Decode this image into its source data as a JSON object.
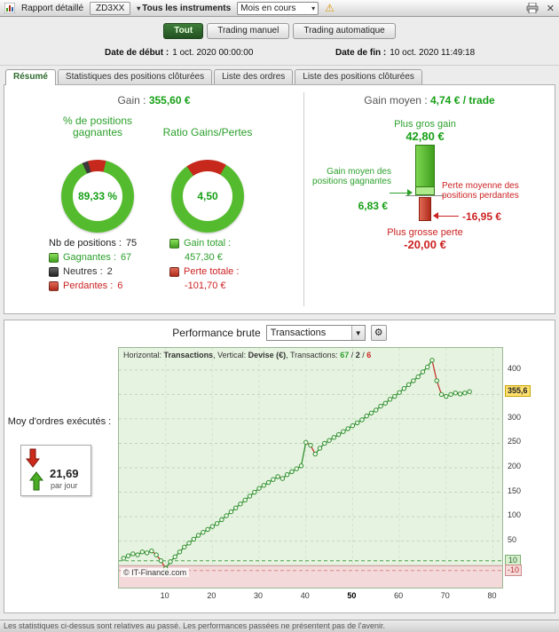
{
  "titlebar": {
    "title": "Rapport détaillé",
    "doc_tab": "ZD3XX",
    "instruments": "Tous les instruments",
    "period": "Mois en cours"
  },
  "filters": {
    "options": [
      "Tout",
      "Trading manuel",
      "Trading automatique"
    ],
    "selected": "Tout"
  },
  "dates": {
    "start_label": "Date de début :",
    "start_value": "1 oct. 2020 00:00:00",
    "end_label": "Date de fin :",
    "end_value": "10 oct. 2020 11:49:18"
  },
  "tabs": {
    "items": [
      "Résumé",
      "Statistiques des positions clôturées",
      "Liste des ordres",
      "Liste des positions clôturées"
    ],
    "active": "Résumé"
  },
  "summary": {
    "gain_label": "Gain :",
    "gain_value": "355,60 €",
    "pct_label": "% de positions gagnantes",
    "ratio_label": "Ratio Gains/Pertes",
    "pct_value": "89,33 %",
    "ratio_value": "4,50",
    "donut1": {
      "neutres": 2.67,
      "perdantes": 8.0,
      "gagnantes": 89.33
    },
    "donut2": {
      "red": 18.2,
      "green": 81.8
    },
    "nb_label": "Nb de positions :",
    "nb_value": "75",
    "legend": [
      {
        "label": "Gagnantes :",
        "value": "67"
      },
      {
        "label": "Neutres :",
        "value": "2"
      },
      {
        "label": "Perdantes :",
        "value": "6"
      }
    ],
    "gain_total_label": "Gain total :",
    "gain_total_value": "457,30 €",
    "perte_totale_label": "Perte totale :",
    "perte_totale_value": "-101,70 €"
  },
  "gain_moyen": {
    "label": "Gain moyen :",
    "value": "4,74 € / trade",
    "plus_gros_gain_label": "Plus gros gain",
    "plus_gros_gain": "42,80 €",
    "gain_moyen_gagnantes_label": "Gain moyen des positions gagnantes",
    "gain_moyen_gagnantes": "6,83 €",
    "perte_moyenne_label": "Perte moyenne des positions perdantes",
    "perte_moyenne": "-16,95 €",
    "plus_grosse_perte_label": "Plus grosse perte",
    "plus_grosse_perte": "-20,00 €"
  },
  "performance": {
    "title": "Performance brute",
    "dropdown_value": "Transactions",
    "moy_label": "Moy d'ordres exécutés :",
    "moy_value": "21,69",
    "moy_unit": "par jour"
  },
  "chart_data": {
    "type": "line",
    "title": "Performance brute",
    "header": {
      "h_label": "Horizontal:",
      "h_value": "Transactions",
      "v_label": ", Vertical:",
      "v_value": "Devise (€)",
      "t_label": ", Transactions:",
      "wins": "67",
      "slash1": " / ",
      "neutral": "2",
      "slash2": " / ",
      "losses": "6"
    },
    "values": [
      15,
      20,
      24,
      22,
      28,
      26,
      30,
      22,
      10,
      -6,
      8,
      18,
      28,
      38,
      46,
      54,
      62,
      68,
      74,
      80,
      86,
      94,
      102,
      110,
      118,
      126,
      134,
      142,
      150,
      158,
      164,
      170,
      176,
      182,
      178,
      186,
      192,
      198,
      204,
      252,
      246,
      228,
      240,
      250,
      256,
      262,
      268,
      274,
      280,
      286,
      292,
      298,
      306,
      312,
      318,
      326,
      332,
      340,
      346,
      354,
      362,
      370,
      378,
      386,
      396,
      406,
      420,
      378,
      350,
      346,
      350,
      353,
      351,
      353,
      355.6
    ],
    "current_value": 355.6,
    "current_label": "355,6",
    "yticks": [
      50,
      100,
      150,
      200,
      250,
      300,
      350,
      400
    ],
    "xticks": [
      10,
      20,
      30,
      40,
      50,
      60,
      70,
      80
    ],
    "xticks_bold": [
      50
    ],
    "ylim": [
      -45,
      445
    ],
    "xlim": [
      0,
      82
    ],
    "threshold_upper": 10,
    "threshold_lower": -10,
    "zero_line": 0,
    "copyright": "© IT-Finance.com"
  },
  "statusbar": {
    "text": "Les statistiques ci-dessus sont relatives au passé. Les performances passées ne présentent pas de l'avenir."
  }
}
